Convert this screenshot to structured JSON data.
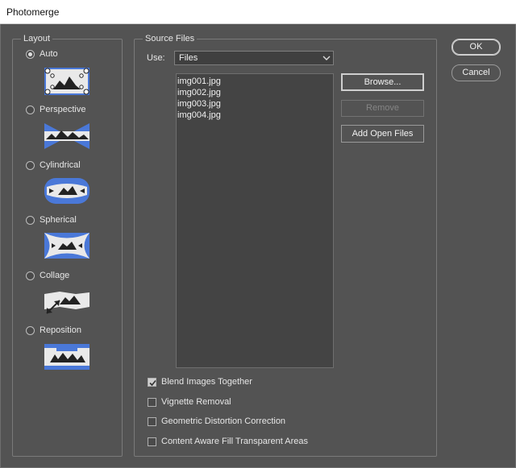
{
  "window": {
    "title": "Photomerge"
  },
  "layout": {
    "legend": "Layout",
    "options": [
      {
        "label": "Auto",
        "checked": true,
        "icon": "auto-layout-icon"
      },
      {
        "label": "Perspective",
        "checked": false,
        "icon": "perspective-layout-icon"
      },
      {
        "label": "Cylindrical",
        "checked": false,
        "icon": "cylindrical-layout-icon"
      },
      {
        "label": "Spherical",
        "checked": false,
        "icon": "spherical-layout-icon"
      },
      {
        "label": "Collage",
        "checked": false,
        "icon": "collage-layout-icon"
      },
      {
        "label": "Reposition",
        "checked": false,
        "icon": "reposition-layout-icon"
      }
    ]
  },
  "source": {
    "legend": "Source Files",
    "use_label": "Use:",
    "use_value": "Files",
    "files": [
      "img001.jpg",
      "img002.jpg",
      "img003.jpg",
      "img004.jpg"
    ],
    "browse_label": "Browse...",
    "remove_label": "Remove",
    "add_open_label": "Add Open Files"
  },
  "options": [
    {
      "label": "Blend Images Together",
      "checked": true
    },
    {
      "label": "Vignette Removal",
      "checked": false
    },
    {
      "label": "Geometric Distortion Correction",
      "checked": false
    },
    {
      "label": "Content Aware Fill Transparent Areas",
      "checked": false
    }
  ],
  "actions": {
    "ok_label": "OK",
    "cancel_label": "Cancel"
  },
  "colors": {
    "background": "#535353",
    "accent_blue": "#4a78d8",
    "thumb_white": "#e9e9e9"
  }
}
